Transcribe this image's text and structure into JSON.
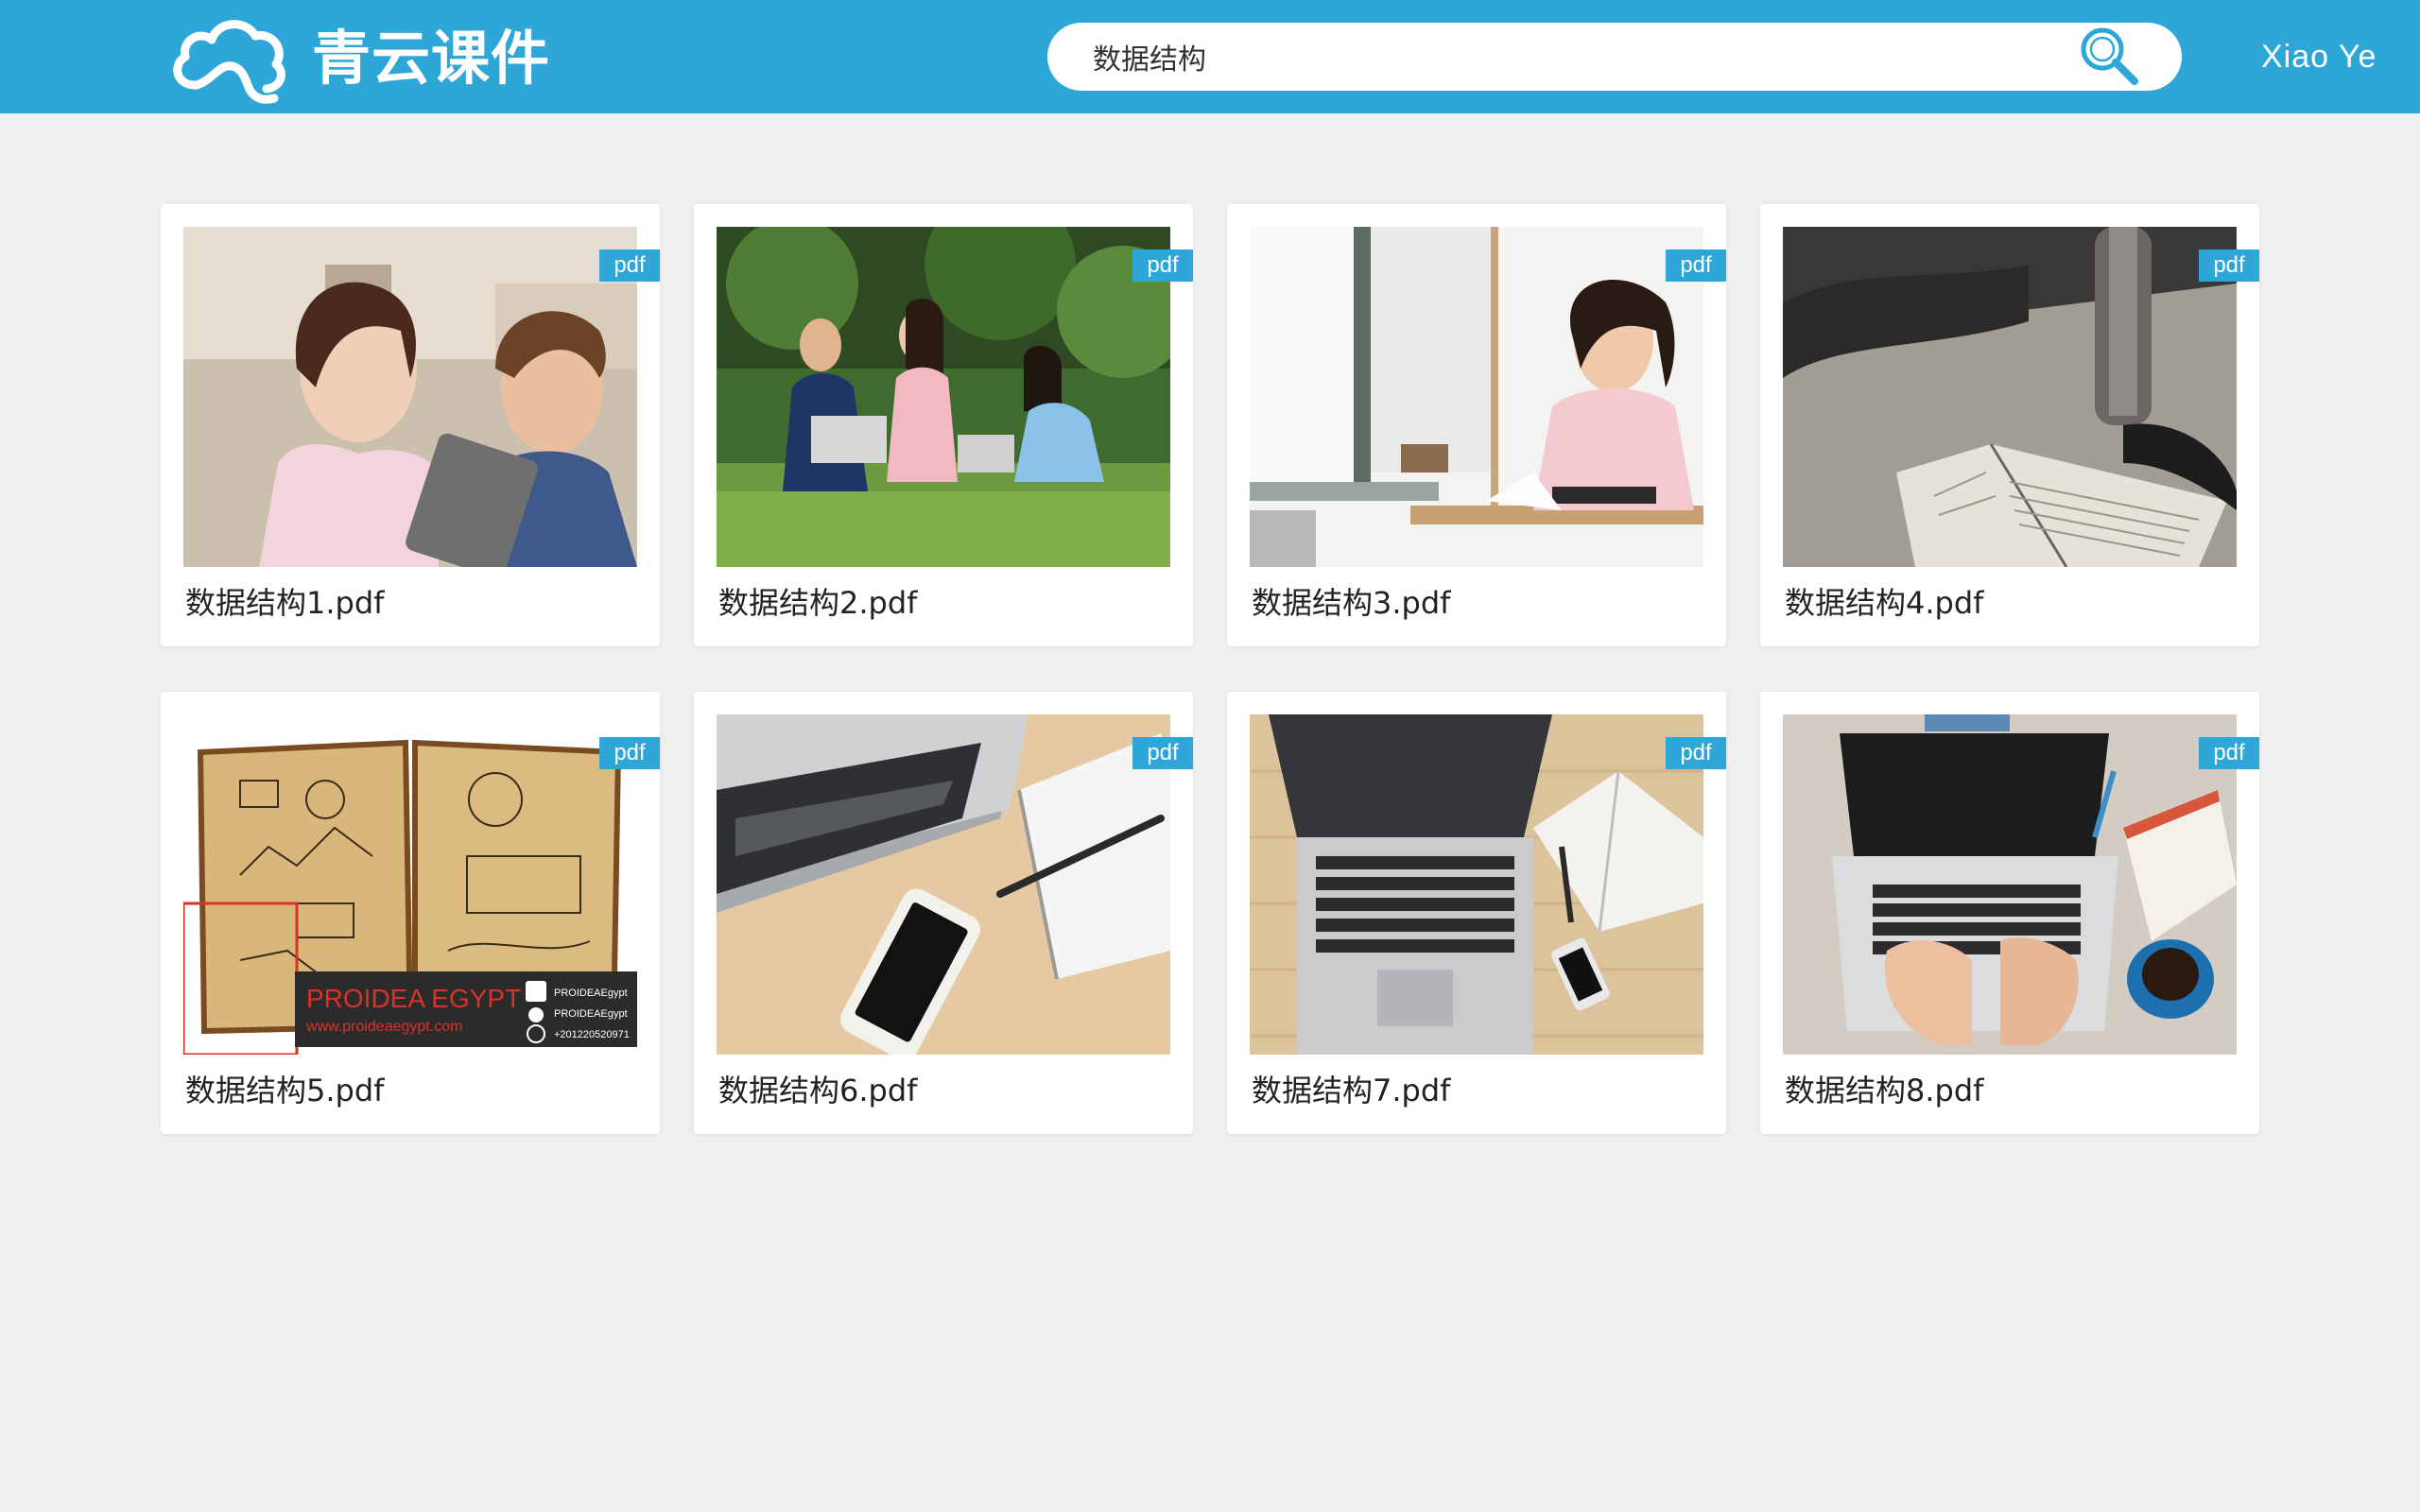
{
  "header": {
    "logo_text": "青云课件",
    "search_value": "数据结构",
    "user_name": "Xiao Ye"
  },
  "colors": {
    "accent": "#2ea7d8",
    "background": "#efefef",
    "card": "#ffffff"
  },
  "icons": {
    "logo": "cloud-logo-icon",
    "search": "search-magnifier-icon"
  },
  "files": [
    {
      "title": "数据结构1.pdf",
      "type": "pdf",
      "thumbnail": "students-with-tablet"
    },
    {
      "title": "数据结构2.pdf",
      "type": "pdf",
      "thumbnail": "students-on-lawn-with-laptops"
    },
    {
      "title": "数据结构3.pdf",
      "type": "pdf",
      "thumbnail": "woman-studying-at-desk"
    },
    {
      "title": "数据结构4.pdf",
      "type": "pdf",
      "thumbnail": "open-book-on-table"
    },
    {
      "title": "数据结构5.pdf",
      "type": "pdf",
      "thumbnail": "sketch-notebook",
      "image_text": {
        "brand": "PROIDEA EGYPT",
        "url": "www.proideaegypt.com",
        "handles": [
          "PROIDEAEgypt",
          "PROIDEAEgypt",
          "+201220520971"
        ]
      }
    },
    {
      "title": "数据结构6.pdf",
      "type": "pdf",
      "thumbnail": "laptop-phone-notebook"
    },
    {
      "title": "数据结构7.pdf",
      "type": "pdf",
      "thumbnail": "laptop-on-wooden-desk"
    },
    {
      "title": "数据结构8.pdf",
      "type": "pdf",
      "thumbnail": "typing-on-laptop-with-coffee"
    }
  ]
}
